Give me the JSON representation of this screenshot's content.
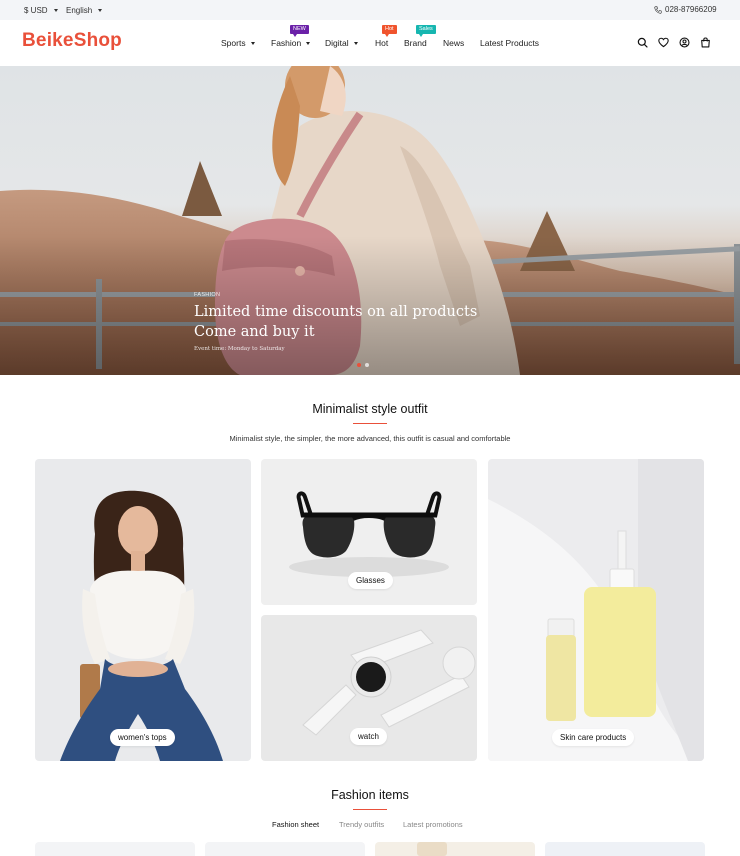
{
  "topbar": {
    "currency": "$ USD",
    "language": "English",
    "phone": "028-87966209"
  },
  "header": {
    "logo": "BeikeShop",
    "nav": [
      {
        "label": "Sports",
        "dropdown": true
      },
      {
        "label": "Fashion",
        "dropdown": true,
        "badge": "NEW",
        "badge_color": "#6b21a8"
      },
      {
        "label": "Digital",
        "dropdown": true
      },
      {
        "label": "Hot",
        "badge": "Hot",
        "badge_color": "#f0542d"
      },
      {
        "label": "Brand",
        "badge": "Sales",
        "badge_color": "#16b6b0"
      },
      {
        "label": "News"
      },
      {
        "label": "Latest Products"
      }
    ],
    "icons": [
      "search-icon",
      "heart-icon",
      "user-icon",
      "cart-icon"
    ]
  },
  "hero": {
    "kicker": "FASHION",
    "title_line1": "Limited time discounts on all products",
    "title_line2": "Come and buy it",
    "subtitle": "Event time: Monday to Saturday",
    "slides": 2,
    "active_slide": 1
  },
  "minimalist": {
    "title": "Minimalist style outfit",
    "description": "Minimalist style, the simpler, the more advanced, this outfit is casual and comfortable",
    "cards": [
      {
        "label": "women's tops"
      },
      {
        "label": "Glasses"
      },
      {
        "label": "watch"
      },
      {
        "label": "Skin care products"
      }
    ]
  },
  "fashion": {
    "title": "Fashion items",
    "tabs": [
      "Fashion sheet",
      "Trendy outfits",
      "Latest promotions"
    ],
    "active_tab": 0
  },
  "colors": {
    "accent": "#e9503a",
    "topbar_bg": "#f3f5f8"
  }
}
